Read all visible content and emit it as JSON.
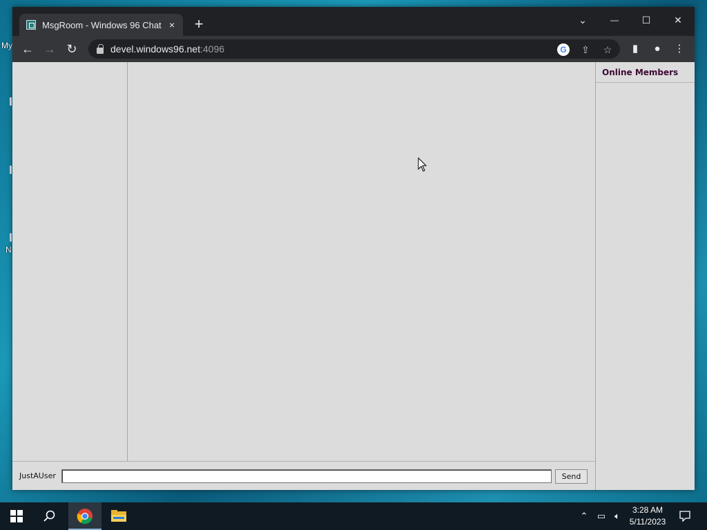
{
  "desktop": {
    "fragments": [
      "My",
      "N"
    ]
  },
  "browser": {
    "tab": {
      "title": "MsgRoom - Windows 96 Chat",
      "close": "×"
    },
    "new_tab": "+",
    "window_controls": {
      "dropdown": "⌄",
      "minimize": "—",
      "maximize": "☐",
      "close": "✕"
    },
    "nav": {
      "back": "←",
      "forward": "→",
      "reload": "↻"
    },
    "address": {
      "host": "devel.windows96.net",
      "port": ":4096"
    },
    "icons": [
      "google-icon",
      "share-icon",
      "star-icon",
      "side-panel-icon",
      "profile-icon",
      "menu-icon"
    ]
  },
  "chat": {
    "members_title": "Online Members",
    "username": "JustAUser",
    "message_input": {
      "value": "",
      "placeholder": ""
    },
    "send_label": "Send"
  },
  "taskbar": {
    "apps": [
      "start-icon",
      "search-icon",
      "chrome-icon",
      "file-explorer-icon"
    ],
    "active_app": "chrome-icon",
    "tray_icons": [
      "chevron-up-icon",
      "network-icon",
      "volume-icon",
      "notification-icon"
    ],
    "time": "3:28 AM",
    "date": "5/11/2023"
  }
}
